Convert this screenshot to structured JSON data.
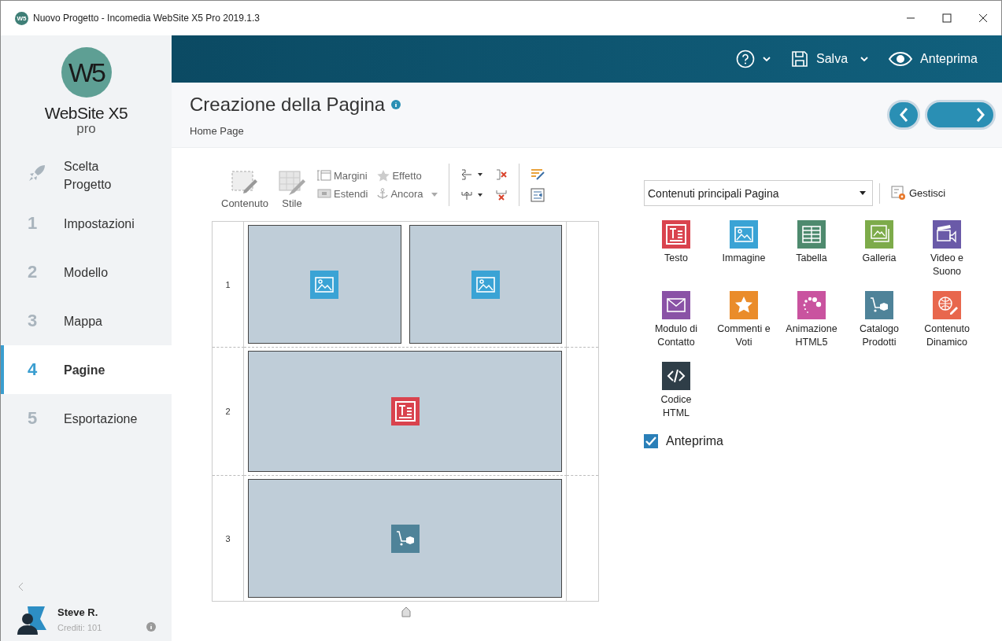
{
  "window": {
    "title": "Nuovo Progetto - Incomedia WebSite X5 Pro 2019.1.3",
    "app_mark": "W5"
  },
  "topbar": {
    "save_label": "Salva",
    "preview_label": "Anteprima"
  },
  "header": {
    "title": "Creazione della Pagina",
    "subtitle": "Home Page"
  },
  "sidebar": {
    "logo_mark": "W5",
    "logo_name": "WebSite X5",
    "logo_edition": "pro",
    "items": [
      {
        "kind": "rocket",
        "label": "Scelta Progetto",
        "selected": false
      },
      {
        "kind": "step",
        "number": "1",
        "label": "Impostazioni",
        "selected": false
      },
      {
        "kind": "step",
        "number": "2",
        "label": "Modello",
        "selected": false
      },
      {
        "kind": "step",
        "number": "3",
        "label": "Mappa",
        "selected": false
      },
      {
        "kind": "step",
        "number": "4",
        "label": "Pagine",
        "selected": true
      },
      {
        "kind": "step",
        "number": "5",
        "label": "Esportazione",
        "selected": false
      }
    ],
    "user": {
      "name": "Steve R.",
      "credits": "Crediti: 101"
    }
  },
  "toolbar": {
    "large": [
      {
        "kind": "content",
        "label": "Contenuto"
      },
      {
        "kind": "style",
        "label": "Stile"
      }
    ],
    "small": [
      {
        "kind": "margins",
        "label": "Margini"
      },
      {
        "kind": "star",
        "label": "Effetto"
      },
      {
        "kind": "stretch",
        "label": "Estendi"
      },
      {
        "kind": "anchor",
        "label": "Ancora"
      }
    ]
  },
  "grid": {
    "rows": [
      {
        "number": "1",
        "cells": [
          {
            "kind": "image"
          },
          {
            "kind": "image"
          }
        ]
      },
      {
        "number": "2",
        "cells": [
          {
            "kind": "text"
          }
        ]
      },
      {
        "number": "3",
        "cells": [
          {
            "kind": "catalog"
          }
        ]
      }
    ]
  },
  "objects": {
    "category": "Contenuti principali Pagina",
    "manage_label": "Gestisci",
    "items": [
      {
        "kind": "text",
        "label": "Testo",
        "color": "#d9434e"
      },
      {
        "kind": "image",
        "label": "Immagine",
        "color": "#3aa3d5"
      },
      {
        "kind": "table",
        "label": "Tabella",
        "color": "#4e8a6e"
      },
      {
        "kind": "gallery",
        "label": "Galleria",
        "color": "#7dab4a"
      },
      {
        "kind": "video",
        "label": "Video e Suono",
        "color": "#6a5aa8"
      },
      {
        "kind": "mail",
        "label": "Modulo di Contatto",
        "color": "#8a52a6"
      },
      {
        "kind": "star",
        "label": "Commenti e Voti",
        "color": "#ea8c2a"
      },
      {
        "kind": "dots",
        "label": "Animazione HTML5",
        "color": "#c9539f"
      },
      {
        "kind": "catalog",
        "label": "Catalogo Prodotti",
        "color": "#4f8399"
      },
      {
        "kind": "globe",
        "label": "Contenuto Dinamico",
        "color": "#e8674d"
      },
      {
        "kind": "code",
        "label": "Codice HTML",
        "color": "#2f3e48"
      }
    ],
    "preview": {
      "label": "Anteprima",
      "checked": true
    }
  }
}
